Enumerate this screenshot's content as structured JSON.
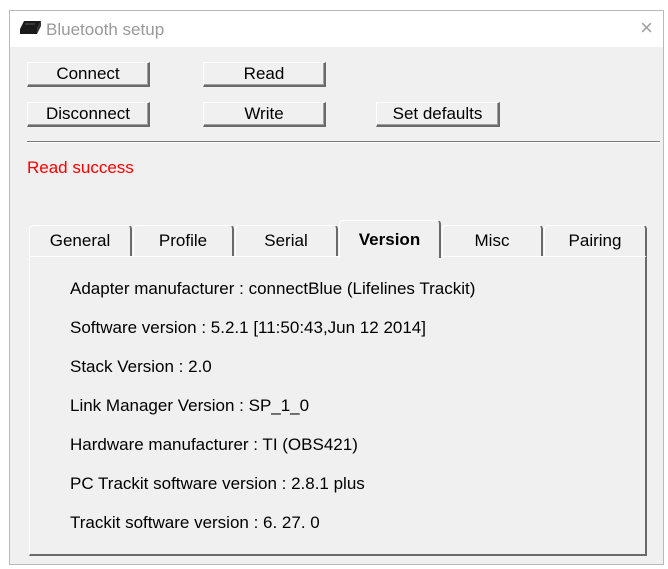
{
  "window": {
    "title": "Bluetooth setup",
    "close_glyph": "×",
    "icon": "bluetooth-device-icon"
  },
  "toolbar": {
    "connect_label": "Connect",
    "read_label": "Read",
    "disconnect_label": "Disconnect",
    "write_label": "Write",
    "set_defaults_label": "Set defaults"
  },
  "status": {
    "text": "Read success",
    "color": "#ff0000"
  },
  "tabs": [
    {
      "label": "General"
    },
    {
      "label": "Profile"
    },
    {
      "label": "Serial"
    },
    {
      "label": "Version",
      "active": true
    },
    {
      "label": "Misc"
    },
    {
      "label": "Pairing"
    }
  ],
  "version_info": [
    "Adapter manufacturer : connectBlue (Lifelines Trackit)",
    "Software version : 5.2.1 [11:50:43,Jun 12 2014]",
    "Stack Version : 2.0",
    "Link Manager Version : SP_1_0",
    "Hardware manufacturer : TI  (OBS421)",
    "PC Trackit software version : 2.8.1 plus",
    "Trackit software version :  6. 27. 0"
  ]
}
